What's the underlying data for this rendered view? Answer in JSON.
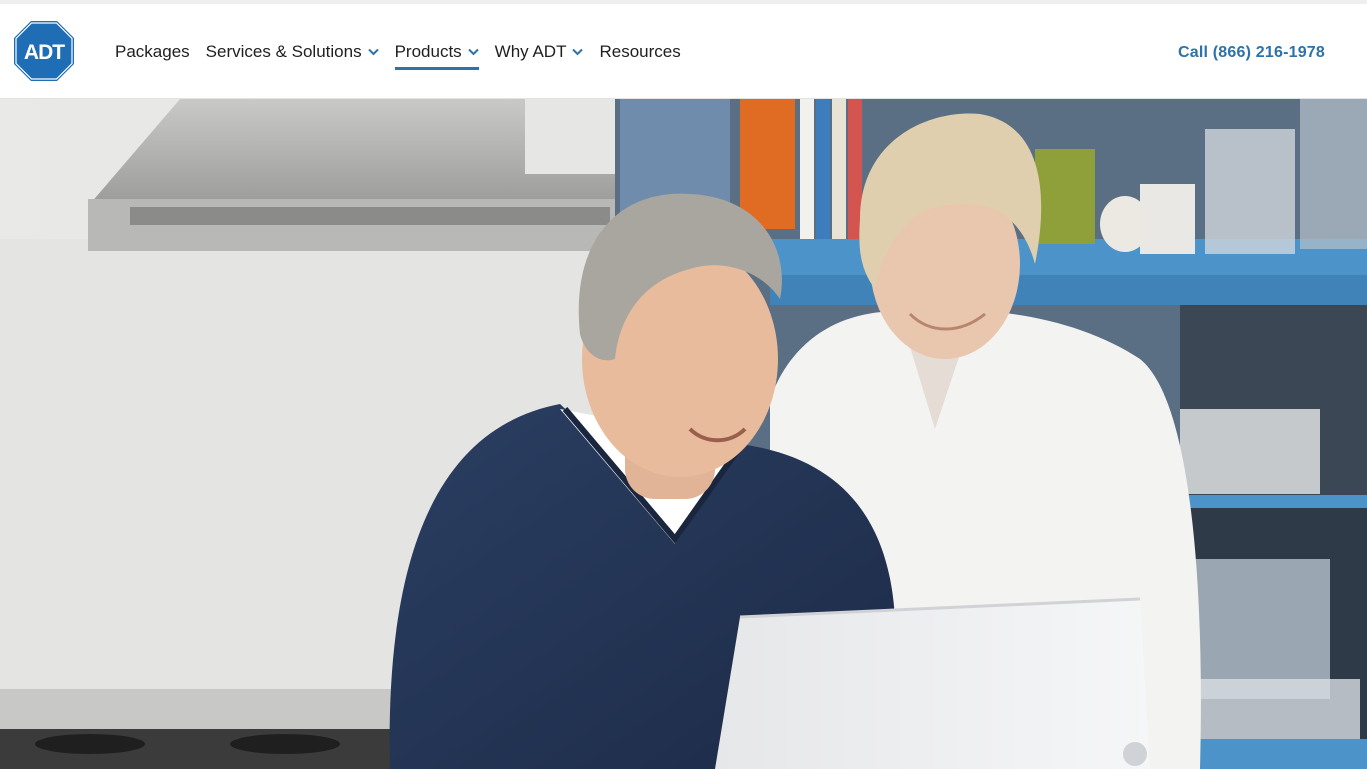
{
  "brand": {
    "logo_text": "ADT",
    "logo_color": "#1f6eb5"
  },
  "nav": {
    "items": [
      {
        "label": "Packages",
        "has_dropdown": false,
        "active": false
      },
      {
        "label": "Services & Solutions",
        "has_dropdown": true,
        "active": false
      },
      {
        "label": "Products",
        "has_dropdown": true,
        "active": true
      },
      {
        "label": "Why ADT",
        "has_dropdown": true,
        "active": false
      },
      {
        "label": "Resources",
        "has_dropdown": false,
        "active": false
      }
    ],
    "accent_color": "#2d72a8",
    "dropdown_icon": "chevron-down-icon"
  },
  "header": {
    "call_label": "Call (866) 216-1978"
  },
  "hero": {
    "image_subject": "couple-using-laptop-in-kitchen"
  }
}
